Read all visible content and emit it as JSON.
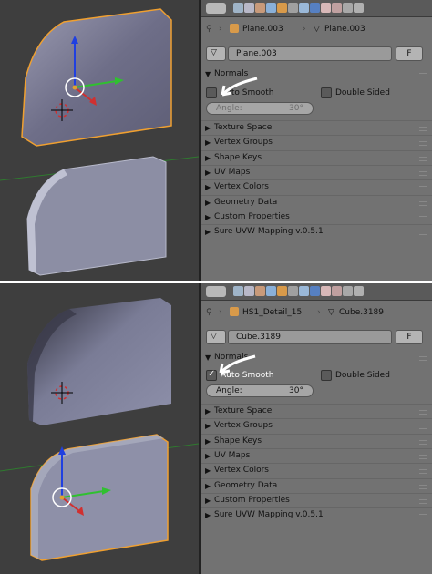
{
  "top": {
    "breadcrumb": {
      "mesh": "Plane.003",
      "data": "Plane.003"
    },
    "datablock": {
      "name": "Plane.003",
      "fake_user": "F"
    },
    "normals": {
      "title": "Normals",
      "auto_smooth": "Auto Smooth",
      "auto_smooth_checked": false,
      "double_sided": "Double Sided",
      "double_sided_checked": false,
      "angle_label": "Angle:",
      "angle_value": "30°"
    },
    "panels": [
      "Texture Space",
      "Vertex Groups",
      "Shape Keys",
      "UV Maps",
      "Vertex Colors",
      "Geometry Data",
      "Custom Properties",
      "Sure UVW Mapping v.0.5.1"
    ]
  },
  "bottom": {
    "breadcrumb": {
      "object": "HS1_Detail_15",
      "data": "Cube.3189"
    },
    "datablock": {
      "name": "Cube.3189",
      "fake_user": "F"
    },
    "normals": {
      "title": "Normals",
      "auto_smooth": "Auto Smooth",
      "auto_smooth_checked": true,
      "double_sided": "Double Sided",
      "double_sided_checked": false,
      "angle_label": "Angle:",
      "angle_value": "30°"
    },
    "panels": [
      "Texture Space",
      "Vertex Groups",
      "Shape Keys",
      "UV Maps",
      "Vertex Colors",
      "Geometry Data",
      "Custom Properties",
      "Sure UVW Mapping v.0.5.1"
    ]
  },
  "colors": {
    "active_tab": "#5680c2",
    "selection_outline": "#f0a030",
    "axis_x": "#d03030",
    "axis_y": "#30c030",
    "axis_z": "#2040e0"
  },
  "icons": {
    "header": [
      "editor-type-icon",
      "render-icon",
      "render-layers-icon",
      "scene-icon",
      "world-icon",
      "object-icon",
      "constraints-icon",
      "modifiers-icon",
      "mesh-data-icon",
      "material-icon",
      "texture-icon",
      "particles-icon",
      "physics-icon"
    ]
  }
}
